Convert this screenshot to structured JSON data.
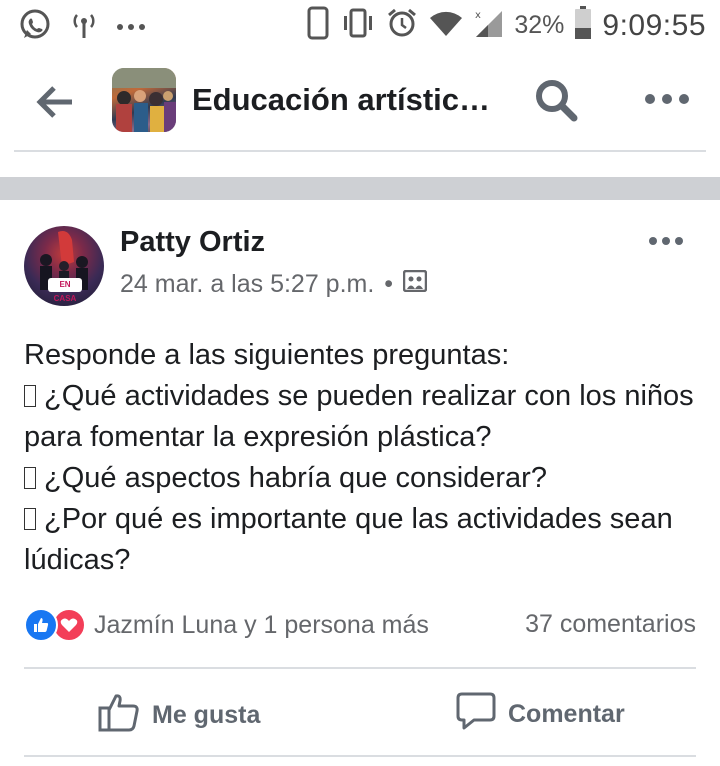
{
  "status_bar": {
    "battery_percent": "32%",
    "time": "9:09:55",
    "icons": [
      "whatsapp-icon",
      "hotspot-icon",
      "more-dots-icon",
      "phone-outline-icon",
      "vibrate-icon",
      "alarm-icon",
      "wifi-icon",
      "signal-icon",
      "battery-icon"
    ]
  },
  "header": {
    "group_title": "Educación artístic…",
    "icons": [
      "back-arrow-icon",
      "search-icon",
      "more-icon"
    ]
  },
  "post": {
    "author": "Patty Ortiz",
    "timestamp": "24 mar. a las 5:27 p.m.",
    "separator": "•",
    "privacy_icon": "group-photo-icon",
    "avatar_badge": "EN CASA",
    "body_intro": "Responde a las siguientes  preguntas:",
    "questions": [
      "¿Qué actividades se pueden realizar con los niños para fomentar la expresión plástica?",
      "¿Qué aspectos habría que considerar?",
      "¿Por qué es importante que las actividades sean lúdicas?"
    ],
    "reactions_text": "Jazmín Luna y 1 persona más",
    "comments_text": "37 comentarios",
    "actions": {
      "like_label": "Me gusta",
      "comment_label": "Comentar"
    }
  },
  "colors": {
    "like_blue": "#1877f2",
    "love_red": "#f33e58",
    "secondary_text": "#65676b",
    "divider": "#dadde1",
    "band": "#ced0d4"
  }
}
